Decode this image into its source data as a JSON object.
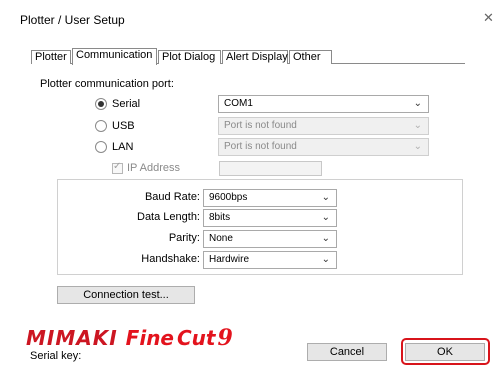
{
  "window": {
    "title": "Plotter / User Setup",
    "close_glyph": "✕"
  },
  "tabs": [
    {
      "label": "Plotter",
      "active": false
    },
    {
      "label": "Communication",
      "active": true
    },
    {
      "label": "Plot Dialog",
      "active": false
    },
    {
      "label": "Alert Display",
      "active": false
    },
    {
      "label": "Other",
      "active": false
    }
  ],
  "communication": {
    "section_label": "Plotter communication port:",
    "ports": [
      {
        "label": "Serial",
        "selected": true,
        "dropdown_value": "COM1",
        "enabled": true
      },
      {
        "label": "USB",
        "selected": false,
        "dropdown_value": "Port is not found",
        "enabled": false
      },
      {
        "label": "LAN",
        "selected": false,
        "dropdown_value": "Port is not found",
        "enabled": false
      }
    ],
    "ip_address": {
      "label": "IP Address",
      "checked": true,
      "enabled": false,
      "value": ""
    },
    "serial_settings": [
      {
        "label": "Baud Rate:",
        "value": "9600bps"
      },
      {
        "label": "Data Length:",
        "value": "8bits"
      },
      {
        "label": "Parity:",
        "value": "None"
      },
      {
        "label": "Handshake:",
        "value": "Hardwire"
      }
    ],
    "connection_test_label": "Connection test..."
  },
  "footer": {
    "logo": {
      "brand": "MIMAKI",
      "product": "Fine",
      "product2": "Cut",
      "version": "9"
    },
    "serial_key_label": "Serial key:",
    "cancel_label": "Cancel",
    "ok_label": "OK"
  },
  "colors": {
    "accent_red": "#d8141b",
    "logo_red": "#e3131d"
  },
  "icons": {
    "close": "close-icon",
    "dropdown": "chevron-down-icon"
  }
}
